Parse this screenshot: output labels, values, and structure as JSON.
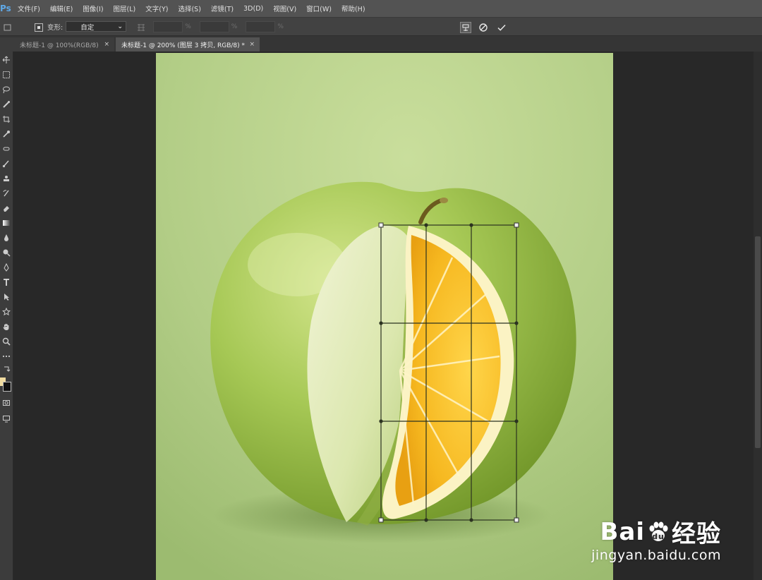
{
  "app": {
    "logo": "Ps"
  },
  "menu": [
    "文件(F)",
    "编辑(E)",
    "图像(I)",
    "图层(L)",
    "文字(Y)",
    "选择(S)",
    "滤镜(T)",
    "3D(D)",
    "视图(V)",
    "窗口(W)",
    "帮助(H)"
  ],
  "options": {
    "warp_label": "变形:",
    "warp_value": "自定",
    "pct": "%",
    "icons": [
      "move-icon",
      "reference-point-icon",
      "warp-mode-icon",
      "cancel-transform-icon",
      "commit-transform-icon"
    ]
  },
  "tabs": [
    {
      "label": "未标题-1 @ 100%(RGB/8)",
      "close": "×",
      "active": false
    },
    {
      "label": "未标题-1 @ 200% (图层 3 拷贝, RGB/8) *",
      "close": "×",
      "active": true
    }
  ],
  "tools": [
    "move-icon",
    "marquee-icon",
    "lasso-icon",
    "quick-select-icon",
    "crop-icon",
    "eyedropper-icon",
    "healing-icon",
    "brush-icon",
    "stamp-icon",
    "history-brush-icon",
    "eraser-icon",
    "gradient-icon",
    "blur-icon",
    "dodge-icon",
    "pen-icon",
    "type-icon",
    "path-select-icon",
    "shape-icon",
    "hand-icon",
    "zoom-icon",
    "more-tools-icon",
    "swap-colors-icon",
    "quick-mask-icon",
    "screen-mode-icon"
  ],
  "colors": {
    "foreground": "#f1dca0",
    "background": "#111111",
    "canvas_bg": "#b4cf8c",
    "apple": "#9cc24e",
    "orange": "#f6b820"
  },
  "watermark": {
    "brand": "Bai",
    "brand2": "经验",
    "url": "jingyan.baidu.com"
  }
}
